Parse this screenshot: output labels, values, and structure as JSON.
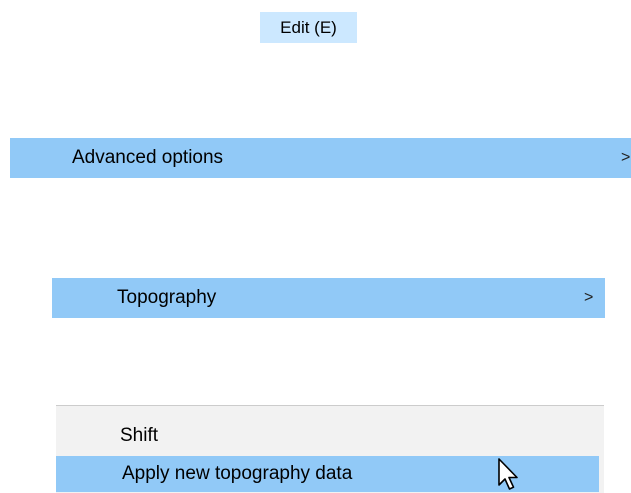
{
  "edit_menu": {
    "title": "Edit (E)"
  },
  "level1": {
    "label": "Advanced options",
    "chevron": ">"
  },
  "level2": {
    "label": "Topography",
    "chevron": ">"
  },
  "level3": {
    "items": [
      {
        "label": "Shift"
      },
      {
        "label": "Apply new topography data"
      }
    ]
  },
  "colors": {
    "header_bg": "#cce8ff",
    "highlight": "#91c9f7",
    "panel_bg": "#f2f2f2"
  },
  "icons": {
    "cursor": "mouse-pointer-icon",
    "submenu_arrow": "chevron-right-icon"
  }
}
